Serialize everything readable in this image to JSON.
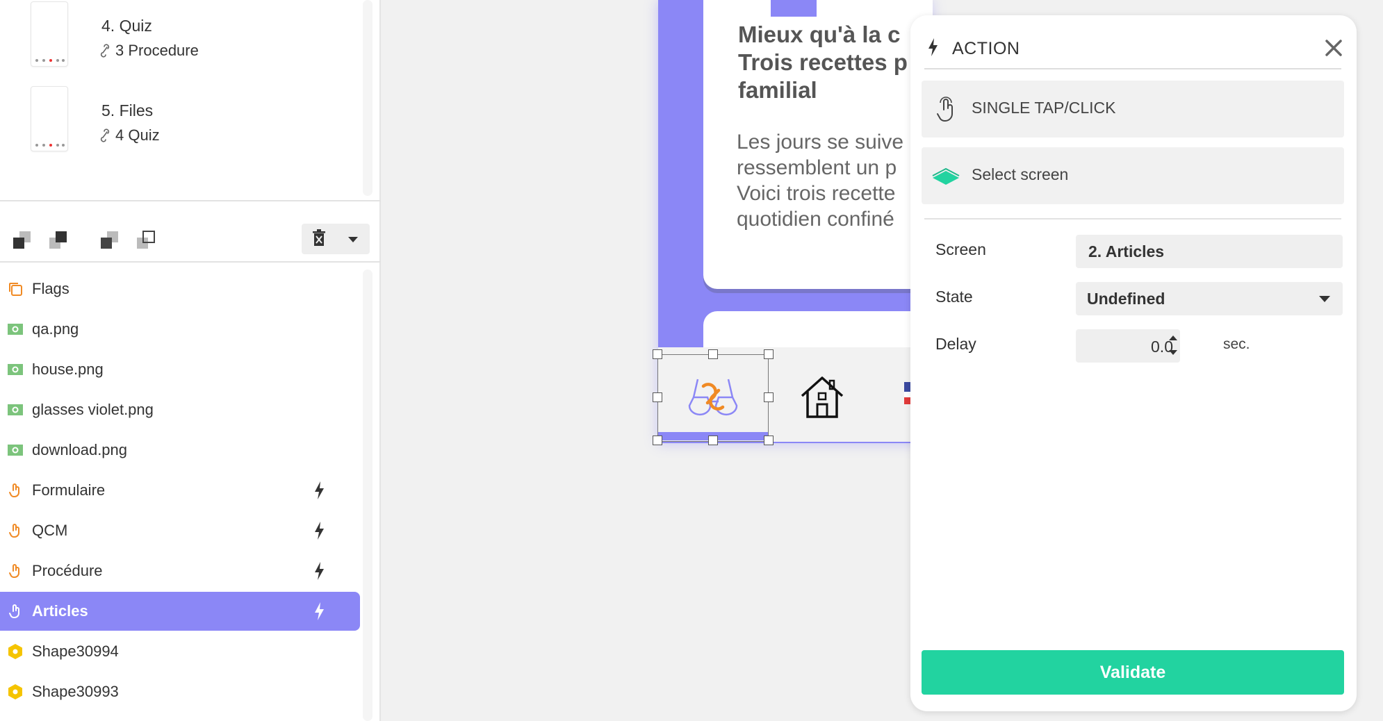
{
  "screens": [
    {
      "title": "4. Quiz",
      "link": "3 Procedure"
    },
    {
      "title": "5. Files",
      "link": "4 Quiz"
    }
  ],
  "layers": [
    {
      "label": "Flags",
      "type": "group",
      "has_action": false,
      "selected": false
    },
    {
      "label": "qa.png",
      "type": "image",
      "has_action": false,
      "selected": false
    },
    {
      "label": "house.png",
      "type": "image",
      "has_action": false,
      "selected": false
    },
    {
      "label": "glasses violet.png",
      "type": "image",
      "has_action": false,
      "selected": false
    },
    {
      "label": "download.png",
      "type": "image",
      "has_action": false,
      "selected": false
    },
    {
      "label": "Formulaire",
      "type": "hotspot",
      "has_action": true,
      "selected": false
    },
    {
      "label": "QCM",
      "type": "hotspot",
      "has_action": true,
      "selected": false
    },
    {
      "label": "Procédure",
      "type": "hotspot",
      "has_action": true,
      "selected": false
    },
    {
      "label": "Articles",
      "type": "hotspot",
      "has_action": true,
      "selected": true
    },
    {
      "label": "Shape30994",
      "type": "shape",
      "has_action": false,
      "selected": false
    },
    {
      "label": "Shape30993",
      "type": "shape",
      "has_action": false,
      "selected": false
    }
  ],
  "canvas": {
    "article_title": "Mieux qu'à la c\nTrois recettes p\nfamilial",
    "article_body": "Les jours se suive\nressemblent un p\nVoici trois recette\nquotidien confiné"
  },
  "action_panel": {
    "title": "ACTION",
    "trigger_label": "SINGLE TAP/CLICK",
    "action_type_label": "Select screen",
    "screen_label": "Screen",
    "screen_value": "2. Articles",
    "state_label": "State",
    "state_value": "Undefined",
    "delay_label": "Delay",
    "delay_value": "0.0",
    "delay_unit": "sec.",
    "validate_label": "Validate"
  },
  "colors": {
    "accent": "#8b87f6",
    "validate": "#22d3a0",
    "hotspot_icon": "#f08a24",
    "image_icon": "#7cc47c",
    "shape_icon": "#f5c400"
  },
  "icons": {
    "group": "layers-icon",
    "image": "image-icon",
    "hotspot": "hand-tap-icon",
    "shape": "hexagon-icon",
    "action": "bolt-icon"
  }
}
